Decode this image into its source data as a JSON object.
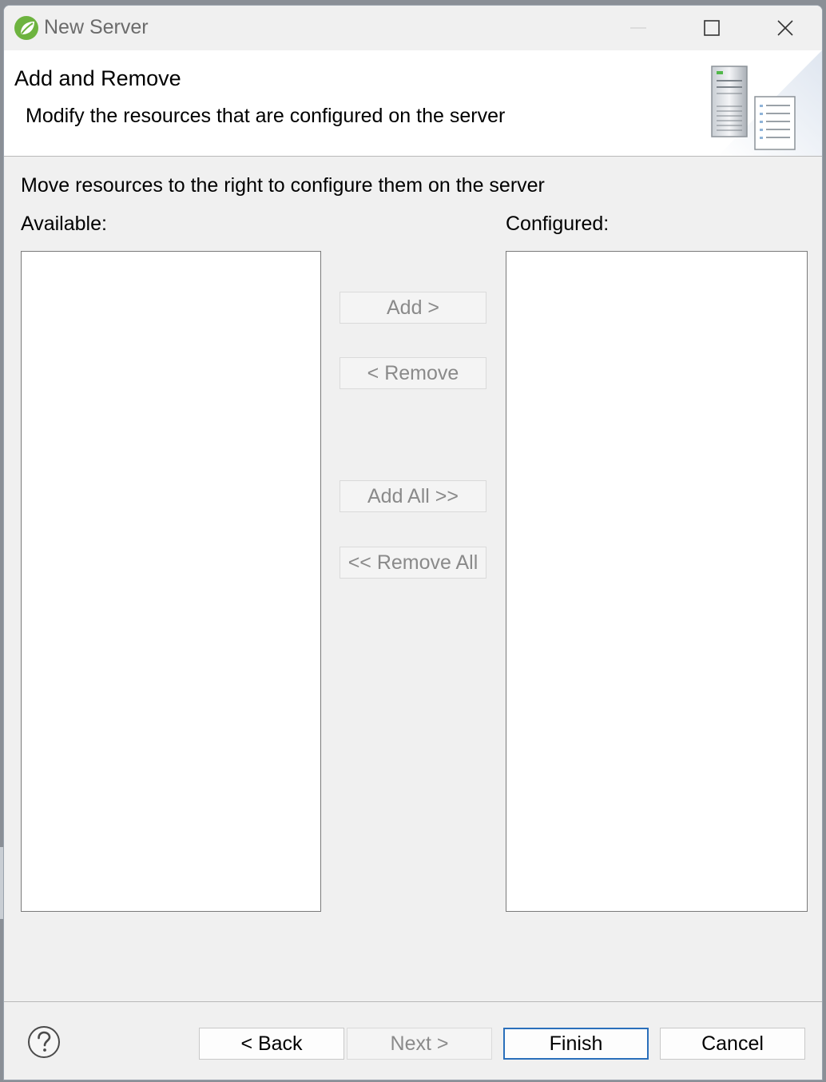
{
  "window": {
    "title": "New Server",
    "controls": {
      "minimize": "minimize",
      "maximize": "maximize",
      "close": "close"
    }
  },
  "header": {
    "title": "Add and Remove",
    "description": "Modify the resources that are configured on the server"
  },
  "body": {
    "instruction": "Move resources to the right to configure them on the server",
    "available_label": "Available:",
    "configured_label": "Configured:",
    "available_items": [],
    "configured_items": [],
    "buttons": {
      "add": "Add >",
      "remove": "< Remove",
      "add_all": "Add All >>",
      "remove_all": "<< Remove All"
    }
  },
  "footer": {
    "back": "< Back",
    "next": "Next >",
    "finish": "Finish",
    "cancel": "Cancel"
  },
  "icons": {
    "app": "spring-leaf-icon",
    "header": "server-wizard-banner-icon",
    "help": "help-question-icon"
  },
  "colors": {
    "dialog_bg": "#f0f0f0",
    "header_bg": "#ffffff",
    "default_button_border": "#2a6fbb",
    "disabled_text": "#8a8a8a",
    "app_icon_green": "#6db33f"
  }
}
